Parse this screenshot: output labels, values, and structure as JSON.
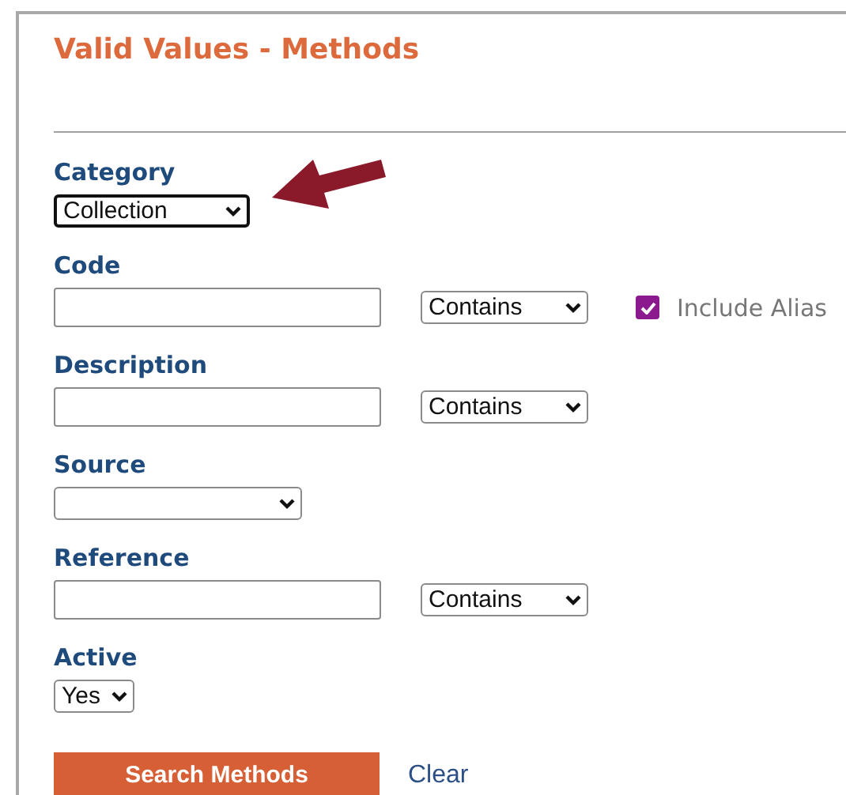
{
  "title": "Valid Values - Methods",
  "fields": [
    {
      "kind": "select",
      "label": "Category",
      "value": "Collection",
      "highlighted": true
    },
    {
      "kind": "text",
      "label": "Code",
      "match": "Contains",
      "checkbox": {
        "label": "Include Alias",
        "checked": true
      }
    },
    {
      "kind": "text",
      "label": "Description",
      "match": "Contains"
    },
    {
      "kind": "select",
      "label": "Source",
      "highlighted": false
    },
    {
      "kind": "text",
      "label": "Reference",
      "match": "Contains"
    },
    {
      "kind": "select",
      "label": "Active",
      "value": "Yes",
      "highlighted": false
    }
  ],
  "buttons": {
    "search": "Search Methods",
    "clear": "Clear"
  }
}
